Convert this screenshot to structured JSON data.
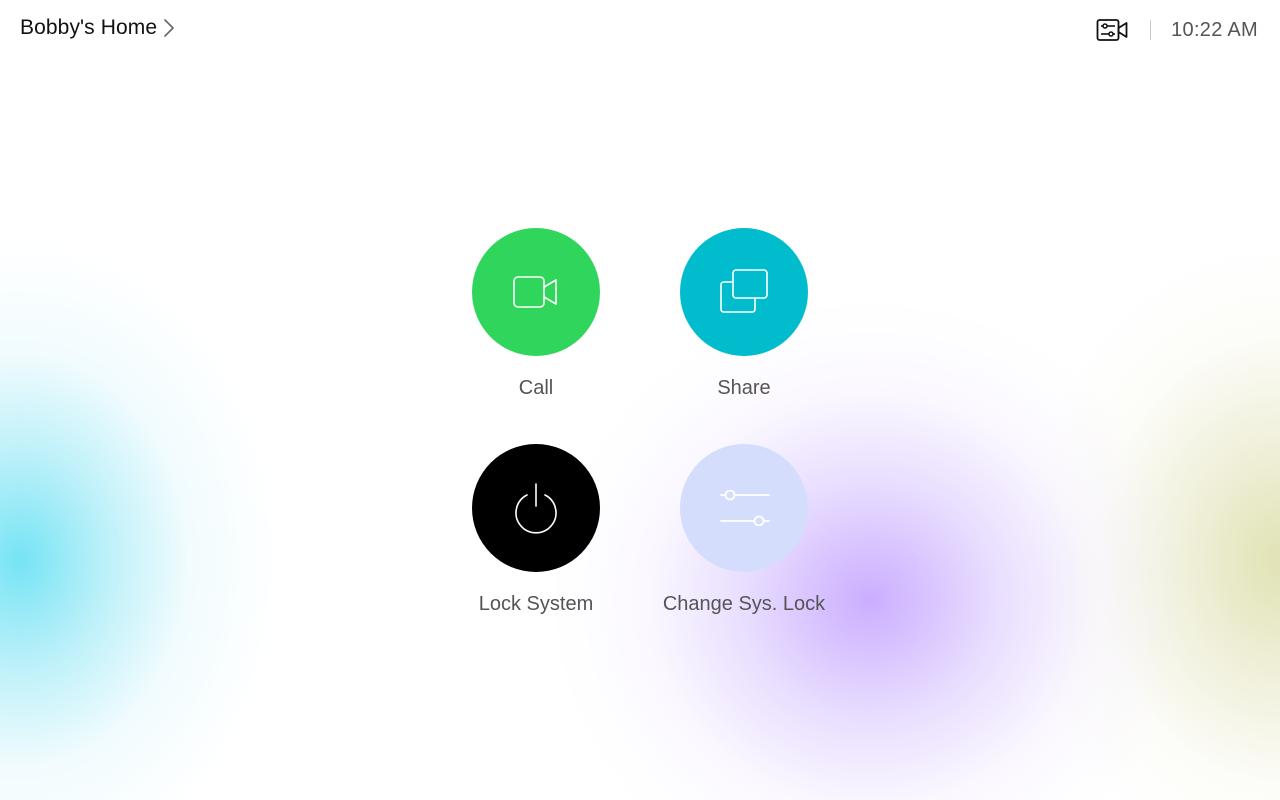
{
  "header": {
    "room_name": "Bobby's Home",
    "chevron_icon": "chevron-right-icon",
    "camera_controls_icon": "camera-controls-icon",
    "time": "10:22 AM"
  },
  "tiles": [
    {
      "label": "Call",
      "icon": "video-camera-icon",
      "color": "#30d65c"
    },
    {
      "label": "Share",
      "icon": "share-screen-icon",
      "color": "#00bccd"
    },
    {
      "label": "Lock System",
      "icon": "power-icon",
      "color": "#000000"
    },
    {
      "label": "Change Sys. Lock",
      "icon": "sliders-icon",
      "color": "#d5ddfd"
    }
  ]
}
